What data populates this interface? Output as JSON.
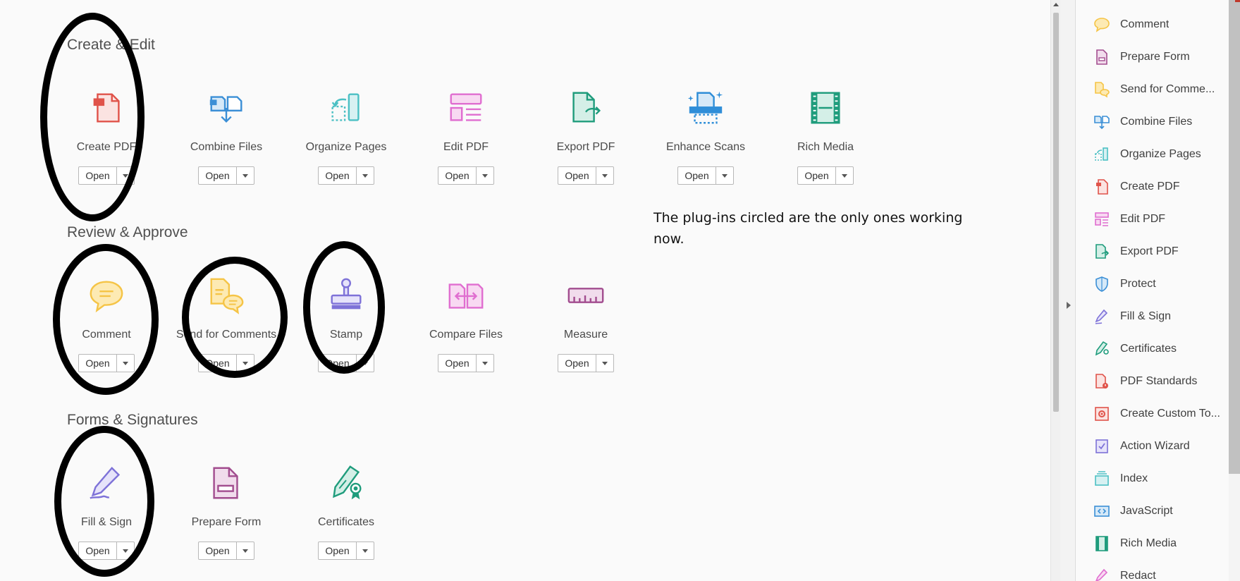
{
  "sections": [
    {
      "title": "Create & Edit",
      "tools": [
        {
          "label": "Create PDF",
          "icon": "create-pdf-icon",
          "open": "Open"
        },
        {
          "label": "Combine Files",
          "icon": "combine-files-icon",
          "open": "Open"
        },
        {
          "label": "Organize Pages",
          "icon": "organize-pages-icon",
          "open": "Open"
        },
        {
          "label": "Edit PDF",
          "icon": "edit-pdf-icon",
          "open": "Open"
        },
        {
          "label": "Export PDF",
          "icon": "export-pdf-icon",
          "open": "Open"
        },
        {
          "label": "Enhance Scans",
          "icon": "enhance-scans-icon",
          "open": "Open"
        },
        {
          "label": "Rich Media",
          "icon": "rich-media-icon",
          "open": "Open"
        }
      ]
    },
    {
      "title": "Review & Approve",
      "tools": [
        {
          "label": "Comment",
          "icon": "comment-icon",
          "open": "Open"
        },
        {
          "label": "Send for Comments",
          "icon": "send-for-comments-icon",
          "open": "Open"
        },
        {
          "label": "Stamp",
          "icon": "stamp-icon",
          "open": "Open"
        },
        {
          "label": "Compare Files",
          "icon": "compare-files-icon",
          "open": "Open"
        },
        {
          "label": "Measure",
          "icon": "measure-icon",
          "open": "Open"
        }
      ]
    },
    {
      "title": "Forms & Signatures",
      "tools": [
        {
          "label": "Fill & Sign",
          "icon": "fill-sign-icon",
          "open": "Open"
        },
        {
          "label": "Prepare Form",
          "icon": "prepare-form-icon",
          "open": "Open"
        },
        {
          "label": "Certificates",
          "icon": "certificates-icon",
          "open": "Open"
        }
      ]
    }
  ],
  "annotation_note": "The plug-ins circled are the only ones working now.",
  "tools_pane": [
    {
      "label": "Comment",
      "icon": "comment-icon"
    },
    {
      "label": "Prepare Form",
      "icon": "prepare-form-icon"
    },
    {
      "label": "Send for Comme...",
      "icon": "send-for-comments-icon"
    },
    {
      "label": "Combine Files",
      "icon": "combine-files-icon"
    },
    {
      "label": "Organize Pages",
      "icon": "organize-pages-icon"
    },
    {
      "label": "Create PDF",
      "icon": "create-pdf-icon"
    },
    {
      "label": "Edit PDF",
      "icon": "edit-pdf-icon"
    },
    {
      "label": "Export PDF",
      "icon": "export-pdf-icon"
    },
    {
      "label": "Protect",
      "icon": "protect-icon"
    },
    {
      "label": "Fill & Sign",
      "icon": "fill-sign-icon"
    },
    {
      "label": "Certificates",
      "icon": "certificates-icon"
    },
    {
      "label": "PDF Standards",
      "icon": "pdf-standards-icon"
    },
    {
      "label": "Create Custom To...",
      "icon": "create-custom-tool-icon"
    },
    {
      "label": "Action Wizard",
      "icon": "action-wizard-icon"
    },
    {
      "label": "Index",
      "icon": "index-icon"
    },
    {
      "label": "JavaScript",
      "icon": "javascript-icon"
    },
    {
      "label": "Rich Media",
      "icon": "rich-media-icon"
    },
    {
      "label": "Redact",
      "icon": "redact-icon"
    }
  ],
  "colors": {
    "create_red": "#e0534a",
    "combine_blue": "#3b8fd6",
    "organize_teal": "#4cc0c4",
    "edit_pink": "#e06ed0",
    "export_green": "#1f9c7c",
    "enhance_blue": "#2f8ed8",
    "comment_yellow": "#f5c446",
    "stamp_purple": "#7e72d8",
    "measure_plum": "#a24d8f",
    "annotation_black": "#000000"
  }
}
